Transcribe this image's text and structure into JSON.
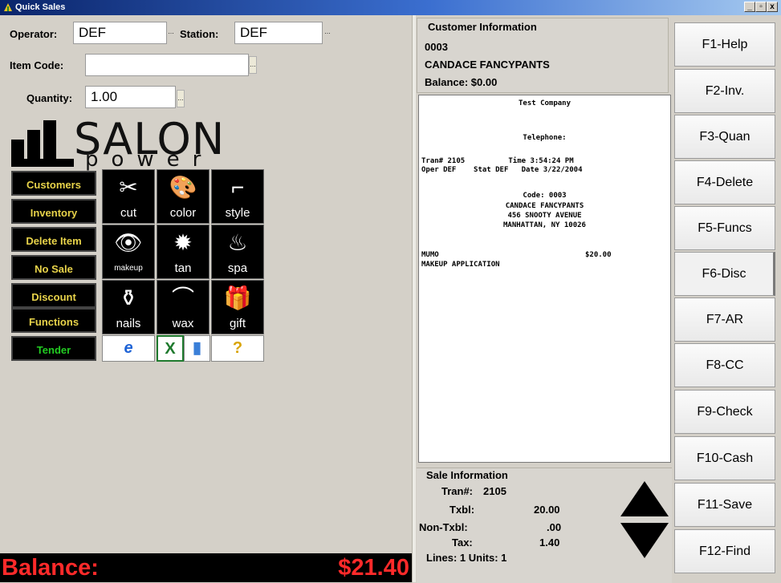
{
  "window": {
    "title": "Quick Sales",
    "controls": [
      "_",
      "▫",
      "x"
    ]
  },
  "header": {
    "operator_label": "Operator:",
    "operator_value": "DEF",
    "station_label": "Station:",
    "station_value": "DEF",
    "item_code_label": "Item Code:",
    "item_code_value": "",
    "quantity_label": "Quantity:",
    "quantity_value": "1.00",
    "ellipsis": "..."
  },
  "logo": {
    "word": "SALON",
    "sub": "power"
  },
  "menu": [
    "Customers",
    "Inventory",
    "Delete Item",
    "No Sale",
    "Discount",
    "Functions",
    "Tender"
  ],
  "services": [
    {
      "label": "cut",
      "icon": "scissors-icon",
      "glyph": "✂"
    },
    {
      "label": "color",
      "icon": "palette-icon",
      "glyph": "🎨"
    },
    {
      "label": "style",
      "icon": "hair-dryer-icon",
      "glyph": "⌐"
    },
    {
      "label": "makeup",
      "icon": "eye-icon",
      "glyph": "👁"
    },
    {
      "label": "tan",
      "icon": "sun-icon",
      "glyph": "✹"
    },
    {
      "label": "spa",
      "icon": "steam-icon",
      "glyph": "♨"
    },
    {
      "label": "nails",
      "icon": "nail-polish-icon",
      "glyph": "⚱"
    },
    {
      "label": "wax",
      "icon": "brow-icon",
      "glyph": "⌒"
    },
    {
      "label": "gift",
      "icon": "gift-icon",
      "glyph": "🎁"
    }
  ],
  "quick_icons": [
    {
      "icon": "internet-explorer-icon",
      "glyph": "e",
      "color": "#1e63d6"
    },
    {
      "icon": "excel-icon",
      "glyph": "X",
      "color": "#1f7a2e"
    },
    {
      "icon": "phone-icon",
      "glyph": "▮",
      "color": "#3a7fd8"
    },
    {
      "icon": "help-icon",
      "glyph": "?",
      "color": "#d9a400"
    }
  ],
  "balance": {
    "label": "Balance:",
    "value": "$21.40"
  },
  "customer": {
    "title": "Customer Information",
    "id": "0003",
    "name": "CANDACE FANCYPANTS",
    "balance": "Balance: $0.00"
  },
  "receipt": {
    "company": "Test Company",
    "telephone": "Telephone:",
    "line1": "Tran# 2105          Time 3:54:24 PM",
    "line2": "Oper DEF    Stat DEF   Date 3/22/2004",
    "code": "Code: 0003",
    "cust_name": "CANDACE FANCYPANTS",
    "address1": "456 SNOOTY AVENUE",
    "address2": "MANHATTAN, NY 10026",
    "item_code": "MUMO",
    "item_price": "$20.00",
    "item_desc": "MAKEUP APPLICATION"
  },
  "sale": {
    "title": "Sale Information",
    "tran_label": "Tran#:",
    "tran_value": "2105",
    "txbl_label": "Txbl:",
    "txbl_value": "20.00",
    "nontxbl_label": "Non-Txbl:",
    "nontxbl_value": ".00",
    "tax_label": "Tax:",
    "tax_value": "1.40",
    "lines": "Lines: 1 Units: 1"
  },
  "fkeys": [
    "F1-Help",
    "F2-Inv.",
    "F3-Quan",
    "F4-Delete",
    "F5-Funcs",
    "F6-Disc",
    "F7-AR",
    "F8-CC",
    "F9-Check",
    "F10-Cash",
    "F11-Save",
    "F12-Find"
  ],
  "colors": {
    "menu_text": "#e8d34a",
    "tender_text": "#22cc22",
    "balance_text": "#ff2a2a"
  }
}
